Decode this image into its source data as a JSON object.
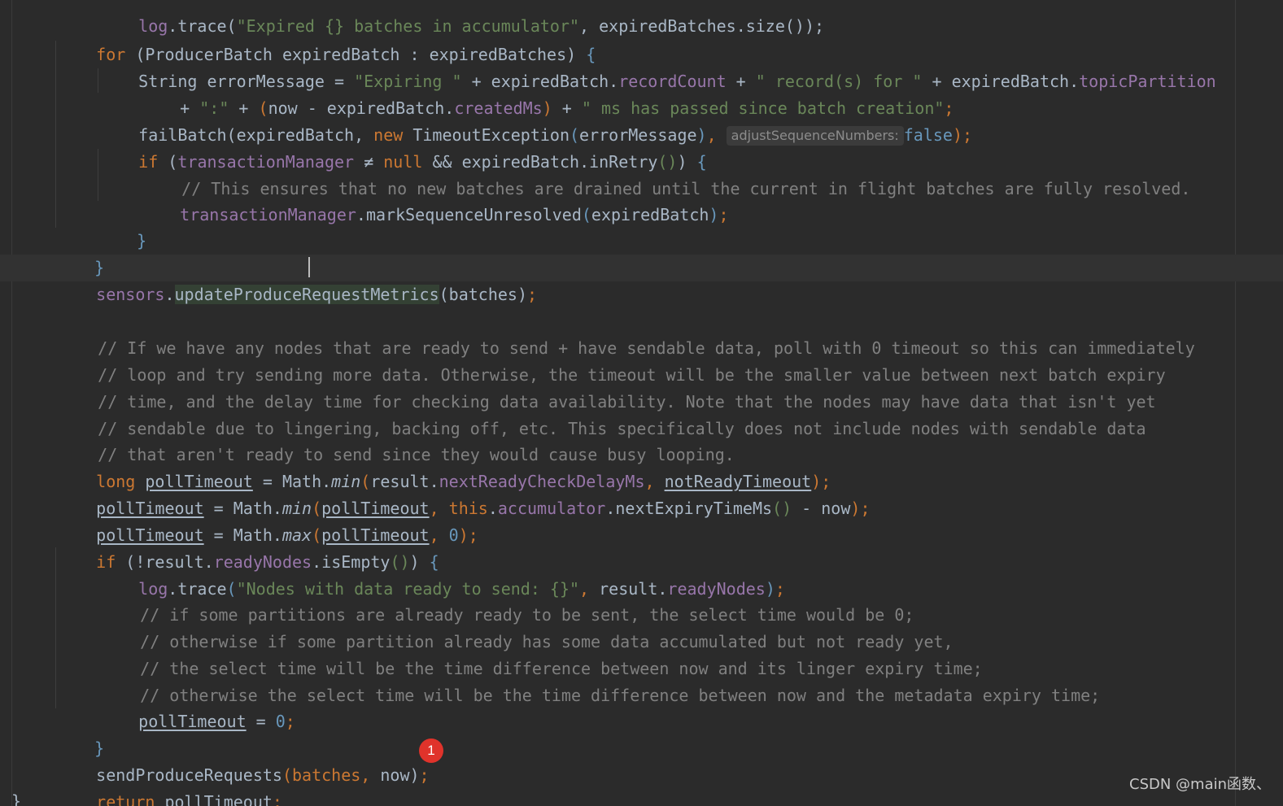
{
  "colors": {
    "background": "#2b2b2b",
    "keyword": "#cc7832",
    "string": "#6a8759",
    "field": "#9876aa",
    "comment": "#808080",
    "number": "#6897bb",
    "plain": "#a9b7c6",
    "marker": "#e0332b"
  },
  "code": {
    "l0": {
      "a": "log",
      "b": ".trace(",
      "c": "\"Expired {} batches in accumulator\"",
      "d": ", expiredBatches.size());"
    },
    "l1": {
      "a": "for",
      "b": " (ProducerBatch expiredBatch : expiredBatches) ",
      "c": "{"
    },
    "l2": {
      "a": "String errorMessage = ",
      "b": "\"Expiring \"",
      "c": " + expiredBatch.",
      "d": "recordCount",
      "e": " + ",
      "f": "\" record(s) for \"",
      "g": " + expiredBatch.",
      "h": "topicPartition"
    },
    "l3": {
      "a": "+ ",
      "b": "\":\"",
      "c": " + ",
      "d": "(",
      "e": "now - expiredBatch.",
      "f": "createdMs",
      "g": ")",
      "h": " + ",
      "i": "\" ms has passed since batch creation\"",
      "j": ";"
    },
    "l4": {
      "a": "failBatch(expiredBatch, ",
      "b": "new",
      "c": " TimeoutException",
      "d": "(",
      "e": "errorMessage",
      "f": ")",
      "g": ", ",
      "hint": "adjustSequenceNumbers:",
      "h": "false",
      "i": ");"
    },
    "l5": {
      "a": "if",
      "b": " (",
      "c": "transactionManager",
      "d": " ≠ ",
      "e": "null",
      "f": " && expiredBatch.inRetry",
      "g": "()",
      "h": ") ",
      "i": "{"
    },
    "l6": {
      "a": "// This ensures that no new batches are drained until the current in flight batches are fully resolved."
    },
    "l7": {
      "a": "transactionManager",
      "b": ".markSequenceUnresolved",
      "c": "(",
      "d": "expiredBatch",
      "e": ")",
      "f": ";"
    },
    "l8": {
      "a": "}"
    },
    "l9": {
      "a": "}"
    },
    "l10": {
      "a": "sensors",
      "b": ".",
      "c": "updateProduceReq",
      "d": "uestMetrics",
      "e": "(batches)",
      "f": ";"
    },
    "l11": {
      "a": "// If we have any nodes that are ready to send + have sendable data, poll with 0 timeout so this can immediately"
    },
    "l12": {
      "a": "// loop and try sending more data. Otherwise, the timeout will be the smaller value between next batch expiry"
    },
    "l13": {
      "a": "// time, and the delay time for checking data availability. Note that the nodes may have data that isn't yet"
    },
    "l14": {
      "a": "// sendable due to lingering, backing off, etc. This specifically does not include nodes with sendable data"
    },
    "l15": {
      "a": "// that aren't ready to send since they would cause busy looping."
    },
    "l16": {
      "a": "long",
      "b": " ",
      "c": "pollTimeout",
      "d": " = Math.",
      "e": "min",
      "f": "(",
      "g": "result.",
      "h": "nextReadyCheckDelayMs",
      "i": ", ",
      "j": "notReadyTimeout",
      "k": ")",
      "l": ";"
    },
    "l17": {
      "a": "pollTimeout",
      "b": " = Math.",
      "c": "min",
      "d": "(",
      "e": "pollTimeout",
      "f": ", ",
      "g": "this",
      "h": ".",
      "i": "accumulator",
      "j": ".nextExpiryTimeMs",
      "k": "()",
      "l": " - now",
      "m": ")",
      "n": ";"
    },
    "l18": {
      "a": "pollTimeout",
      "b": " = Math.",
      "c": "max",
      "d": "(",
      "e": "pollTimeout",
      "f": ", ",
      "g": "0",
      "h": ")",
      "i": ";"
    },
    "l19": {
      "a": "if",
      "b": " (!result.",
      "c": "readyNodes",
      "d": ".isEmpty",
      "e": "()",
      "f": ") ",
      "g": "{"
    },
    "l20": {
      "a": "log",
      "b": ".trace",
      "c": "(",
      "d": "\"Nodes with data ready to send: {}\"",
      "e": ", ",
      "f": "result.",
      "g": "readyNodes",
      "h": ")",
      "i": ";"
    },
    "l21": {
      "a": "// if some partitions are already ready to be sent, the select time would be 0;"
    },
    "l22": {
      "a": "// otherwise if some partition already has some data accumulated but not ready yet,"
    },
    "l23": {
      "a": "// the select time will be the time difference between now and its linger expiry time;"
    },
    "l24": {
      "a": "// otherwise the select time will be the time difference between now and the metadata expiry time;"
    },
    "l25": {
      "a": "pollTimeout",
      "b": " = ",
      "c": "0",
      "d": ";"
    },
    "l26": {
      "a": "}"
    },
    "l27": {
      "a": "sendProduceRequests",
      "b": "(batches",
      "c": ", ",
      "d": "now)",
      "e": ";"
    },
    "l28": {
      "a": "return",
      "b": " ",
      "c": "pollTimeout",
      "d": ";"
    },
    "l29": {
      "a": "}"
    }
  },
  "marker": {
    "label": "1"
  },
  "watermark": {
    "text": "CSDN @main函数、"
  }
}
